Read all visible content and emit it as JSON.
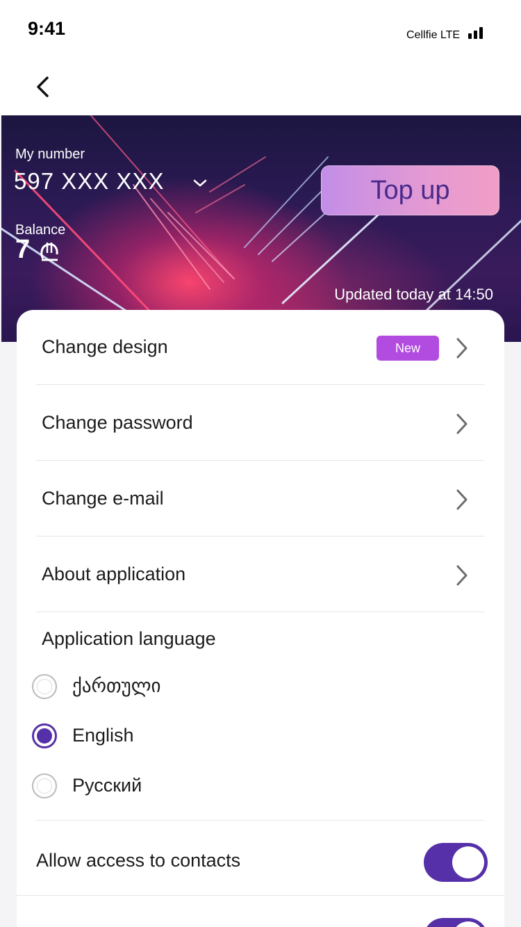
{
  "status_bar": {
    "time": "9:41",
    "carrier": "Cellfie LTE"
  },
  "nav": {
    "back_icon": "chevron-left-icon"
  },
  "account": {
    "my_number_label": "My number",
    "phone_number": "597 XXX XXX",
    "balance_label": "Balance",
    "balance_value": "7",
    "currency_icon": "lari-icon",
    "topup_label": "Top up",
    "updated_text": "Updated today at 14:50"
  },
  "menu": [
    {
      "label": "Change design",
      "badge": "New"
    },
    {
      "label": "Change password"
    },
    {
      "label": "Change e-mail"
    },
    {
      "label": "About application"
    }
  ],
  "language": {
    "title": "Application language",
    "options": [
      {
        "label": "ქართული",
        "selected": false
      },
      {
        "label": "English",
        "selected": true
      },
      {
        "label": "Русский",
        "selected": false
      }
    ]
  },
  "toggles": [
    {
      "label": "Allow access to contacts",
      "on": true
    },
    {
      "label": "",
      "on": true
    }
  ],
  "colors": {
    "accent": "#5630a8",
    "badge": "#b24be0",
    "topup_gradient_start": "#c28ee8",
    "topup_gradient_end": "#f19ec6"
  }
}
